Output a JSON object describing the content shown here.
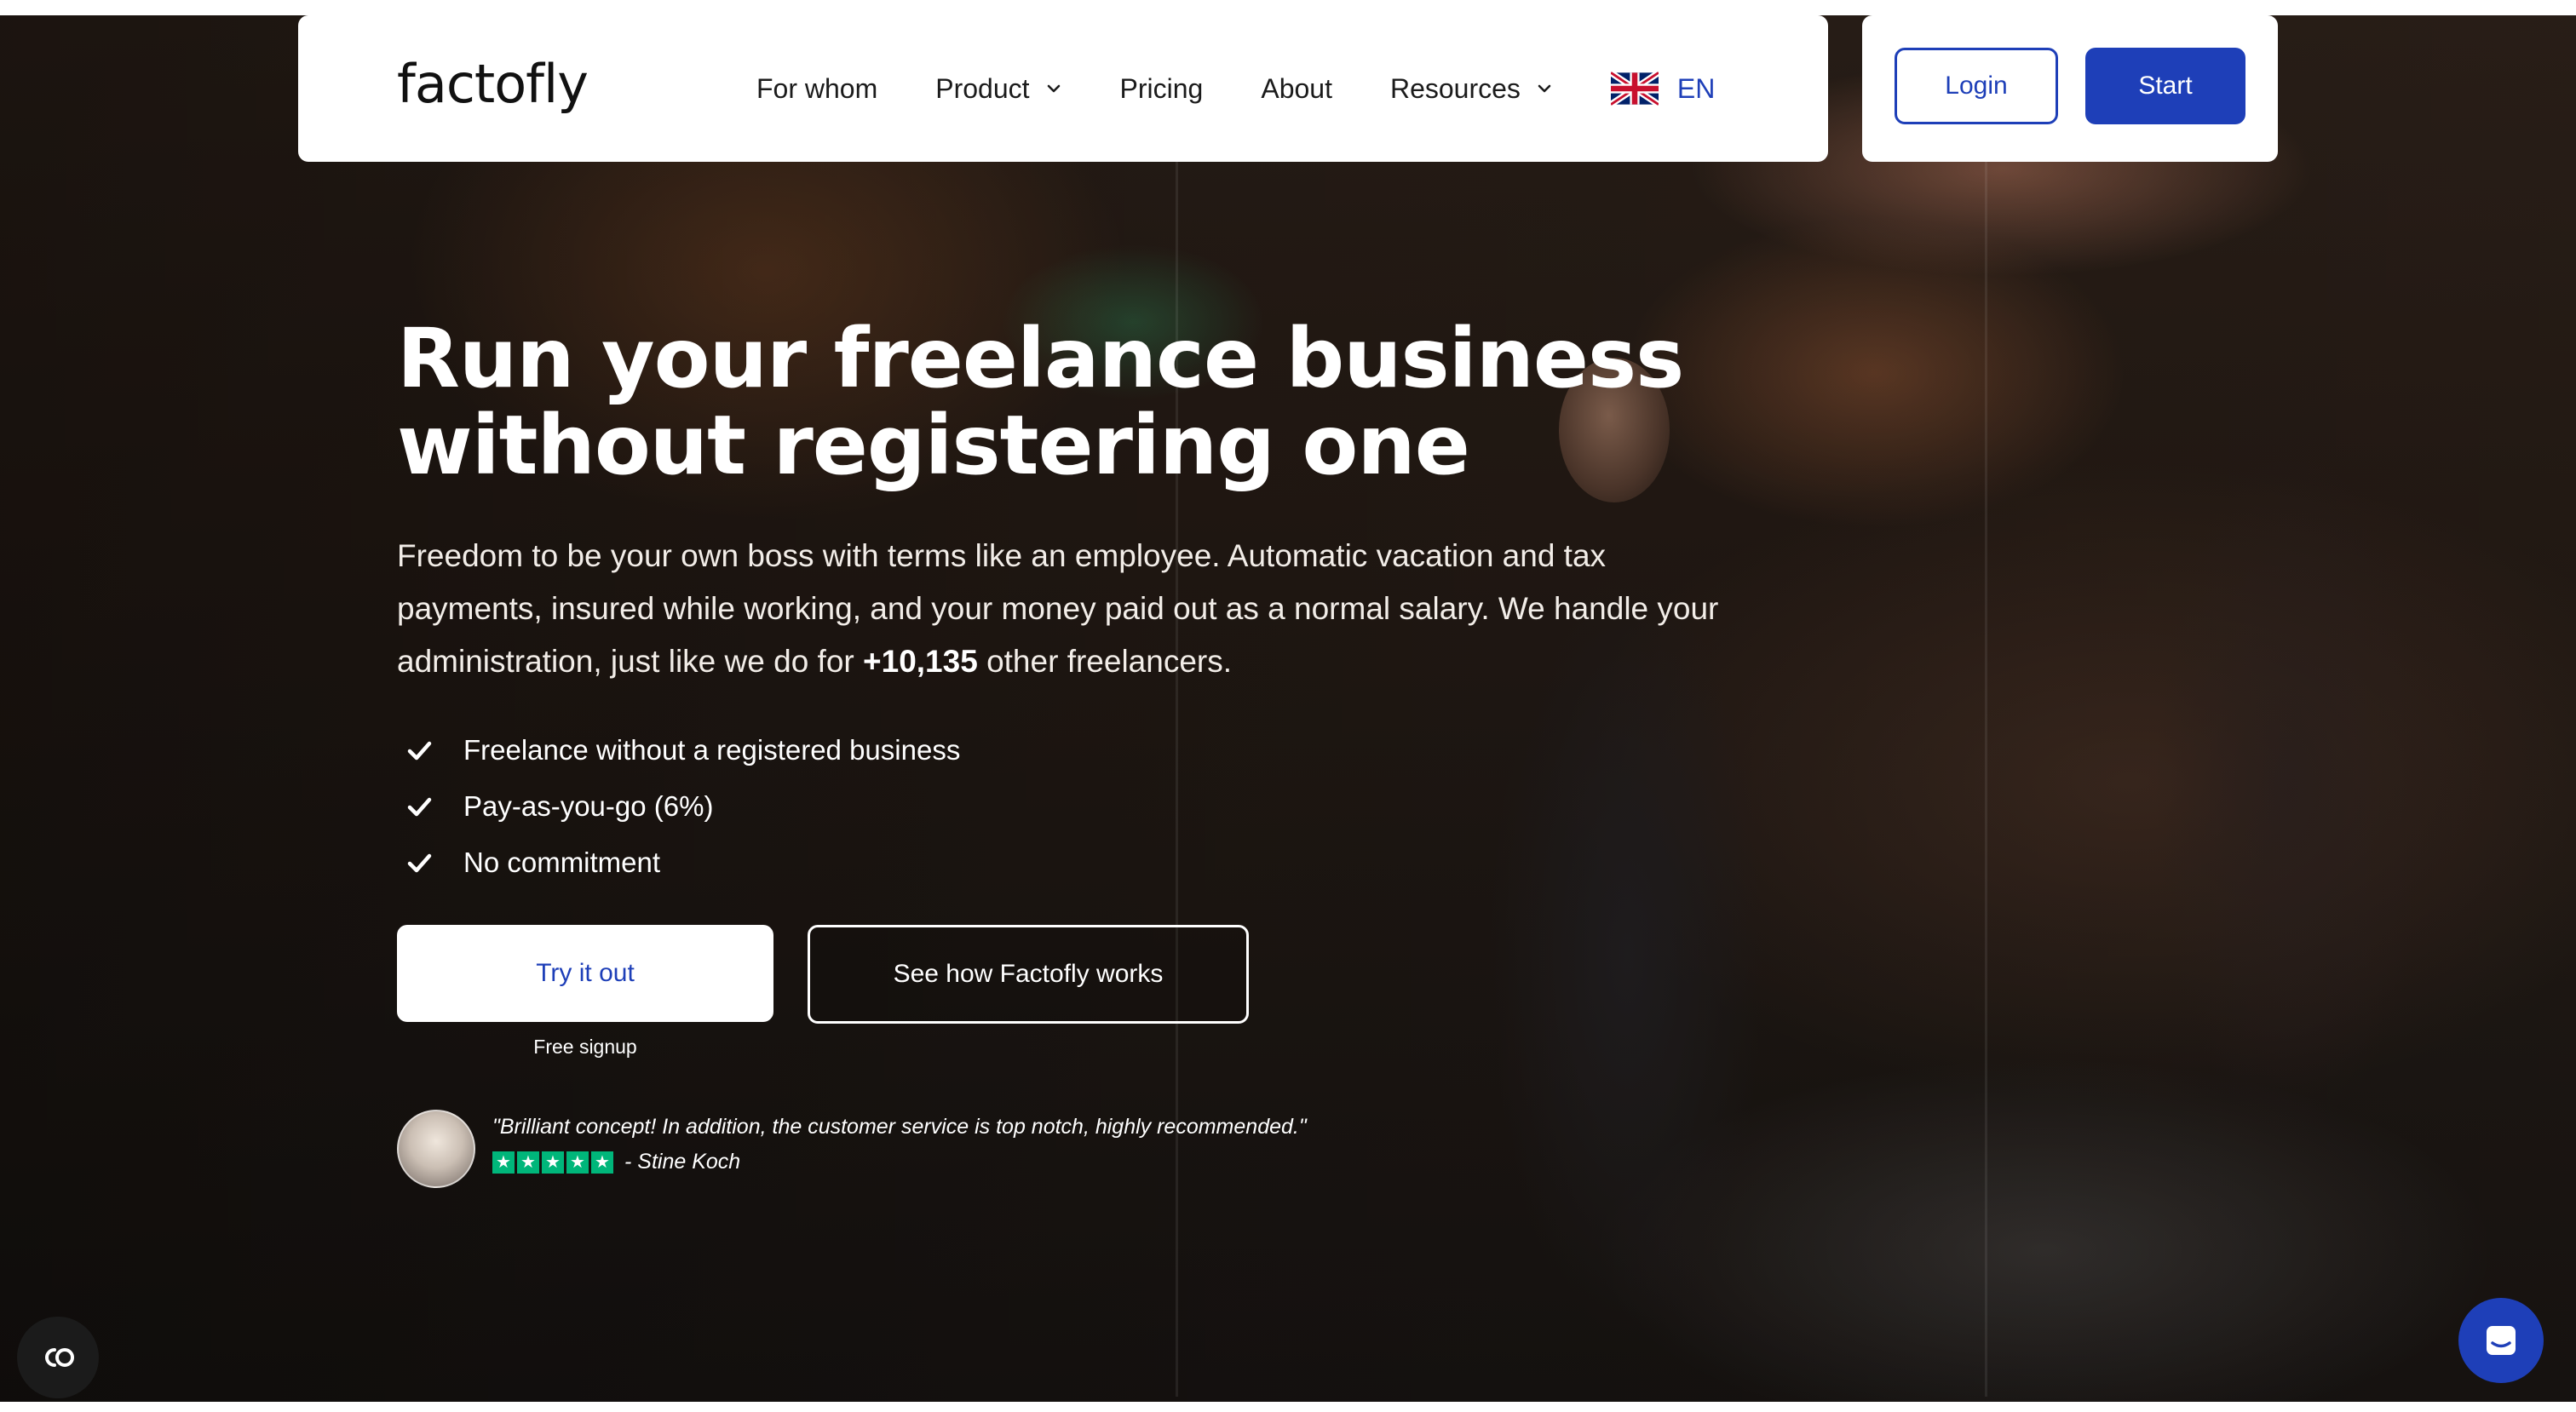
{
  "brand": {
    "logo_text": "factofly"
  },
  "nav": {
    "items": [
      {
        "label": "For whom",
        "has_dropdown": false
      },
      {
        "label": "Product",
        "has_dropdown": true
      },
      {
        "label": "Pricing",
        "has_dropdown": false
      },
      {
        "label": "About",
        "has_dropdown": false
      },
      {
        "label": "Resources",
        "has_dropdown": true
      }
    ],
    "language": {
      "code": "EN",
      "flag_icon": "uk-flag-icon"
    }
  },
  "auth": {
    "login_label": "Login",
    "start_label": "Start"
  },
  "hero": {
    "headline_line1": "Run your freelance business",
    "headline_line2": "without registering one",
    "subtext_before": "Freedom to be your own boss with terms like an employee. Automatic vacation and tax payments, insured while working, and your money paid out as a normal salary. We handle your administration, just like we do for ",
    "subtext_count": "+10,135",
    "subtext_after": " other freelancers.",
    "features": [
      "Freelance without a registered business",
      "Pay-as-you-go (6%)",
      "No commitment"
    ],
    "cta_primary": "Try it out",
    "cta_secondary": "See how Factofly works",
    "cta_note": "Free signup"
  },
  "testimonial": {
    "quote": "\"Brilliant concept! In addition, the customer service is top notch, highly recommended.\"",
    "rating": 5,
    "author": "- Stine Koch"
  },
  "colors": {
    "accent": "#1e3fb8",
    "rating_green": "#00b67a",
    "nav_bg": "#ffffff"
  },
  "icons": {
    "check": "check-icon",
    "chevron": "chevron-down-icon",
    "cookie": "cookie-settings-icon",
    "chat": "chat-icon"
  }
}
